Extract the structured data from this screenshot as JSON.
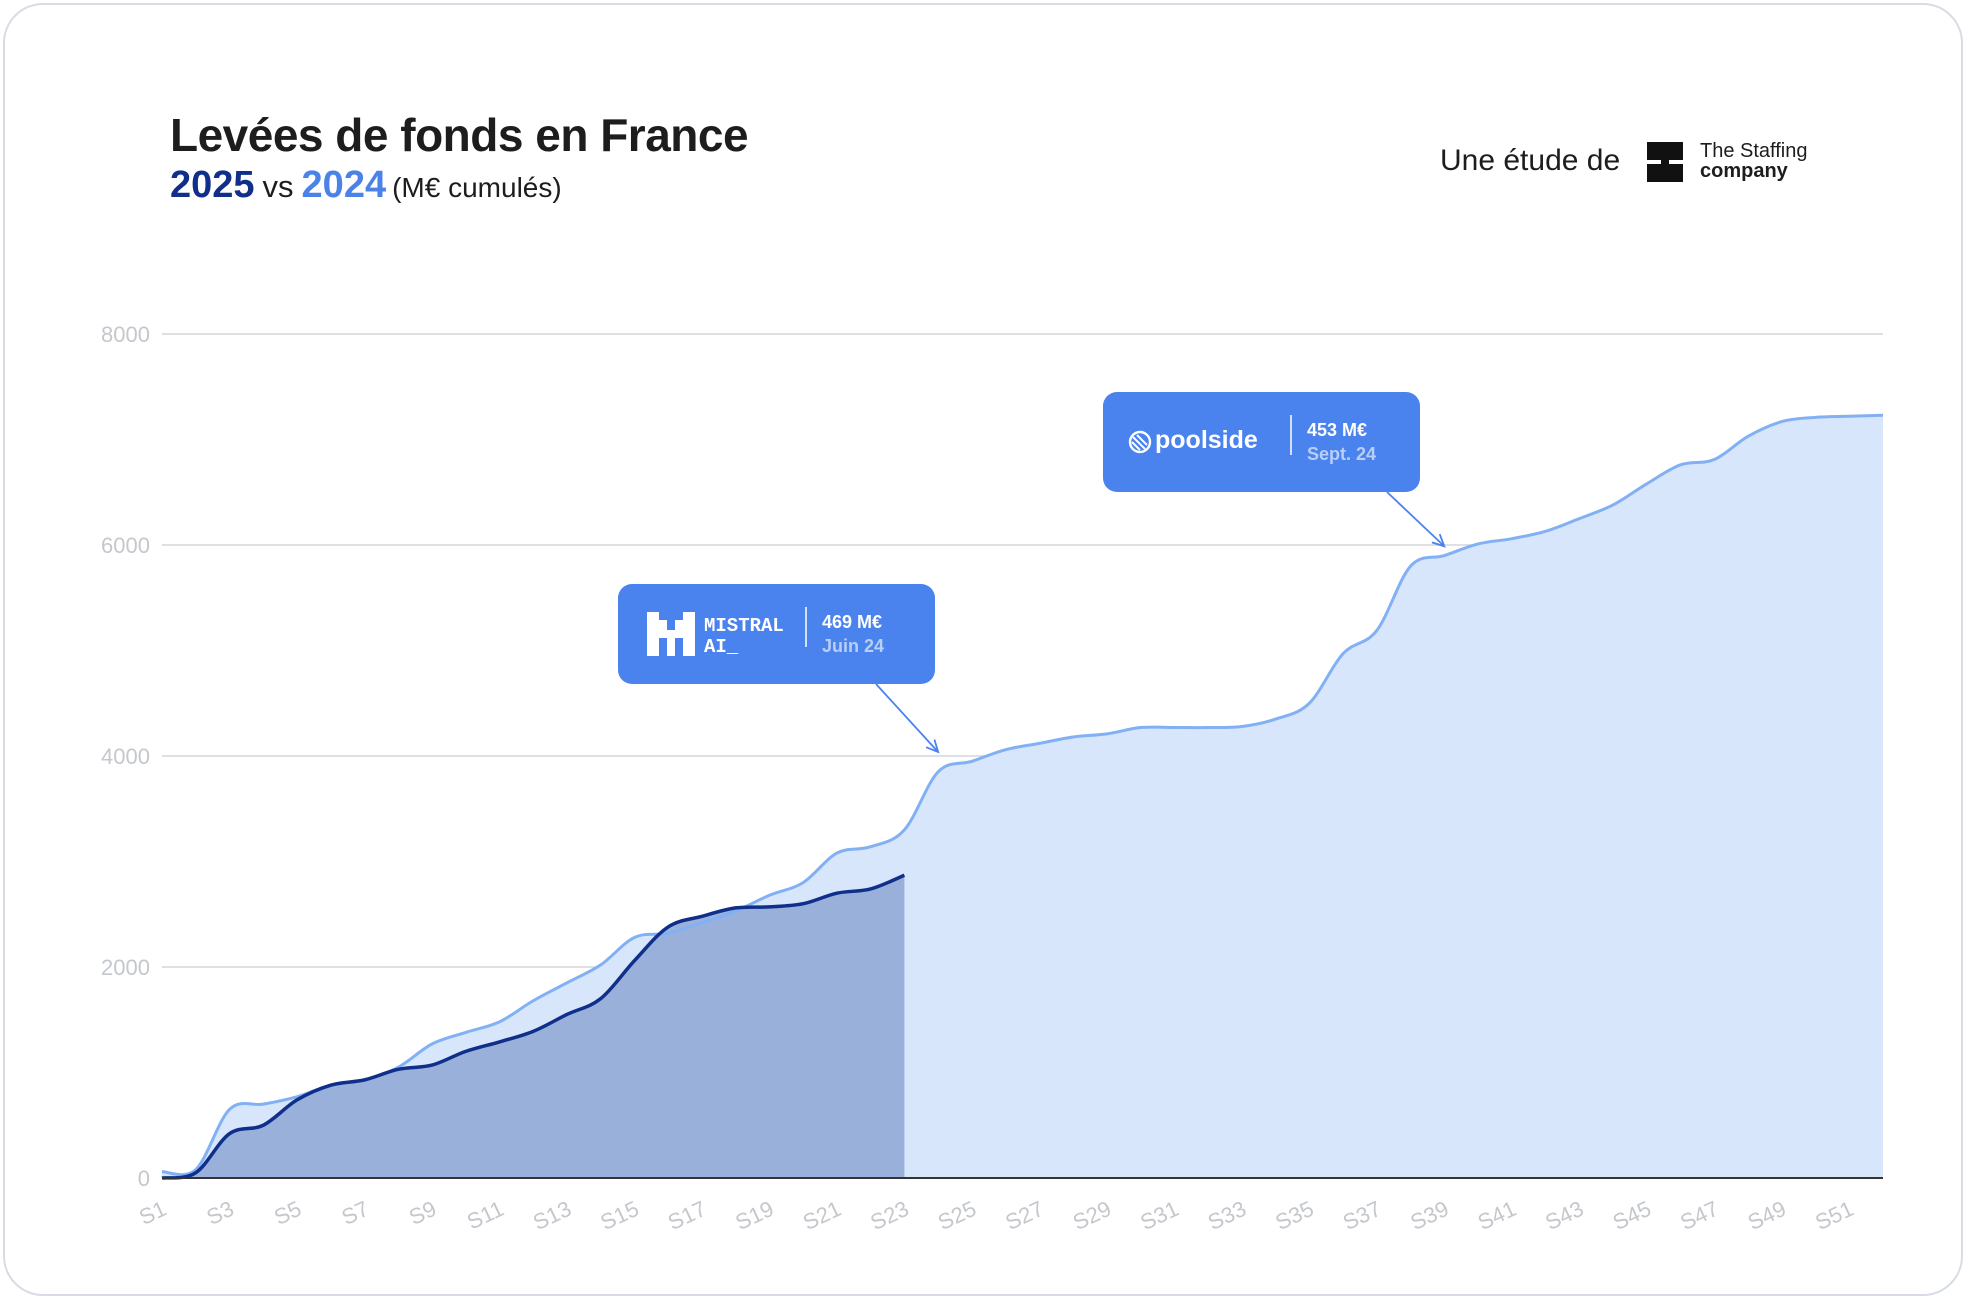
{
  "header": {
    "title": "Levées de fonds en France",
    "year_2025": "2025",
    "vs": "vs",
    "year_2024": "2024",
    "unit": "(M€ cumulés)",
    "study_label": "Une étude de",
    "brand_line1": "The Staffing",
    "brand_line2": "company"
  },
  "callouts": {
    "mistral": {
      "brand_line1": "MISTRAL",
      "brand_line2": "AI_",
      "amount": "469 M€",
      "date": "Juin 24",
      "icon": "mistral-logo-icon"
    },
    "poolside": {
      "brand": "poolside",
      "amount": "453 M€",
      "date": "Sept. 24",
      "icon": "poolside-logo-icon"
    }
  },
  "colors": {
    "series_2025_line": "#0f2f8a",
    "series_2025_fill": "#95add8",
    "series_2024_line": "#82b0f5",
    "series_2024_fill": "#d8e6fb",
    "callout_bg": "#4a82ee",
    "grid": "#d3d6db",
    "axis_text": "#c4c7cc"
  },
  "chart_data": {
    "type": "area",
    "yticks": [
      0,
      2000,
      4000,
      6000,
      8000
    ],
    "ylim": [
      0,
      8000
    ],
    "xlim": [
      1,
      52
    ],
    "xtick_labels": [
      "S1",
      "S3",
      "S5",
      "S7",
      "S9",
      "S11",
      "S13",
      "S15",
      "S17",
      "S19",
      "S21",
      "S23",
      "S25",
      "S27",
      "S29",
      "S31",
      "S33",
      "S35",
      "S37",
      "S39",
      "S41",
      "S43",
      "S45",
      "S47",
      "S49",
      "S51"
    ],
    "series": [
      {
        "name": "2024",
        "x": [
          1,
          2,
          3,
          4,
          5,
          6,
          7,
          8,
          9,
          10,
          11,
          12,
          13,
          14,
          15,
          16,
          17,
          18,
          19,
          20,
          21,
          22,
          23,
          24,
          25,
          26,
          27,
          28,
          29,
          30,
          31,
          32,
          33,
          34,
          35,
          36,
          37,
          38,
          39,
          40,
          41,
          42,
          43,
          44,
          45,
          46,
          47,
          48,
          49,
          50,
          51,
          52
        ],
        "values": [
          60,
          80,
          650,
          700,
          770,
          880,
          930,
          1050,
          1270,
          1380,
          1480,
          1680,
          1850,
          2020,
          2280,
          2320,
          2420,
          2530,
          2680,
          2800,
          3080,
          3140,
          3300,
          3850,
          3950,
          4060,
          4120,
          4180,
          4210,
          4270,
          4270,
          4270,
          4280,
          4350,
          4500,
          4970,
          5190,
          5800,
          5900,
          6010,
          6060,
          6130,
          6250,
          6380,
          6580,
          6760,
          6810,
          7030,
          7170,
          7210,
          7220,
          7230
        ]
      },
      {
        "name": "2025",
        "x": [
          1,
          2,
          3,
          4,
          5,
          6,
          7,
          8,
          9,
          10,
          11,
          12,
          13,
          14,
          15,
          16,
          17,
          18,
          19,
          20,
          21,
          22,
          23
        ],
        "values": [
          0,
          50,
          420,
          500,
          740,
          880,
          930,
          1030,
          1070,
          1200,
          1290,
          1390,
          1550,
          1700,
          2060,
          2380,
          2480,
          2560,
          2570,
          2600,
          2700,
          2740,
          2870
        ]
      }
    ],
    "annotations": [
      {
        "label": "469 M€ Juin 24",
        "x": 24,
        "y": 4000
      },
      {
        "label": "453 M€ Sept. 24",
        "x": 39,
        "y": 5950
      }
    ]
  }
}
